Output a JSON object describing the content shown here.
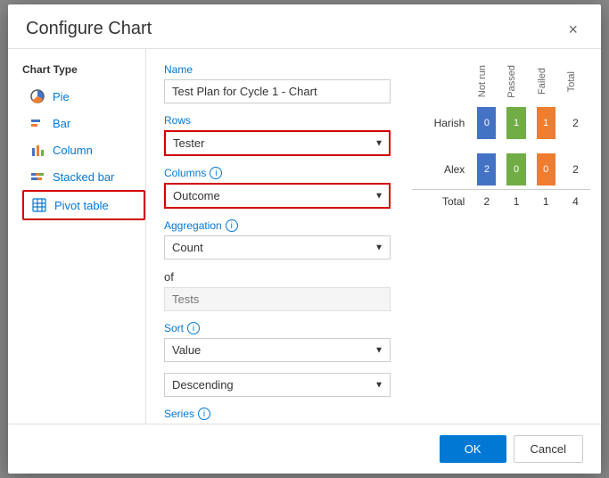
{
  "dialog": {
    "title": "Configure Chart",
    "close_label": "×"
  },
  "sidebar": {
    "title": "Chart Type",
    "items": [
      {
        "id": "pie",
        "label": "Pie",
        "icon": "●",
        "selected": false
      },
      {
        "id": "bar",
        "label": "Bar",
        "icon": "▦",
        "selected": false
      },
      {
        "id": "column",
        "label": "Column",
        "icon": "▤",
        "selected": false
      },
      {
        "id": "stacked-bar",
        "label": "Stacked bar",
        "icon": "▤",
        "selected": false
      },
      {
        "id": "pivot-table",
        "label": "Pivot table",
        "icon": "⊞",
        "selected": true
      }
    ]
  },
  "form": {
    "name_label": "Name",
    "name_value": "Test Plan for Cycle 1 - Chart",
    "rows_label": "Rows",
    "rows_value": "Tester",
    "columns_label": "Columns",
    "columns_value": "Outcome",
    "aggregation_label": "Aggregation",
    "aggregation_value": "Count",
    "of_label": "of",
    "of_placeholder": "Tests",
    "sort_label": "Sort",
    "sort_value": "Value",
    "sort_dir_value": "Descending",
    "series_label": "Series"
  },
  "chart": {
    "col_headers": [
      "Not run",
      "Passed",
      "Failed",
      "Total"
    ],
    "rows": [
      {
        "label": "Harish",
        "not_run": 0,
        "passed": 1,
        "failed": 1,
        "total": 2
      },
      {
        "label": "Alex",
        "not_run": 2,
        "passed": 0,
        "failed": 0,
        "total": 2
      }
    ],
    "totals": {
      "label": "Total",
      "not_run": 2,
      "passed": 1,
      "failed": 1,
      "grand": 4
    }
  },
  "footer": {
    "ok_label": "OK",
    "cancel_label": "Cancel"
  }
}
